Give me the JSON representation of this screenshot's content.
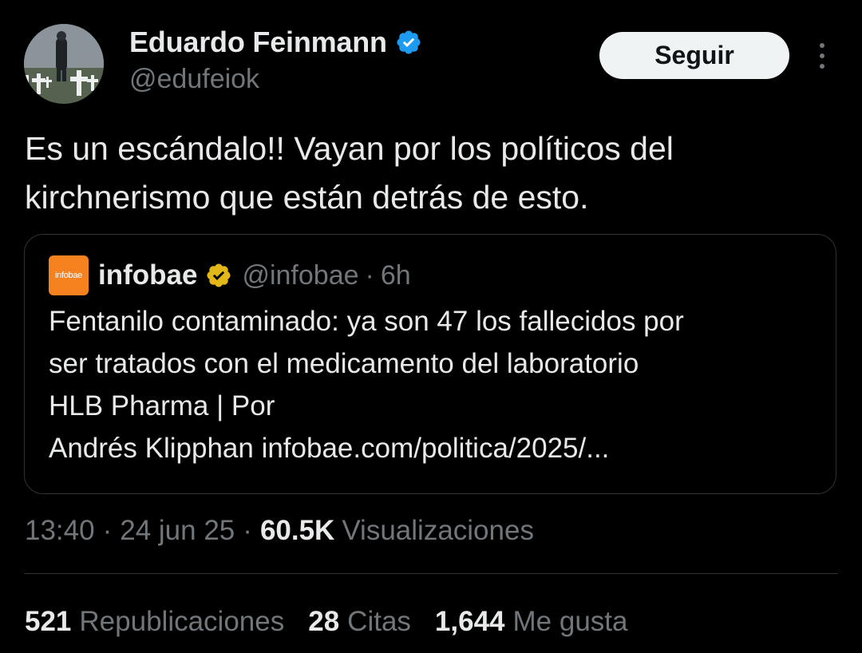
{
  "author": {
    "display_name": "Eduardo Feinmann",
    "handle": "@edufeiok",
    "verified_color": "#1d9bf0",
    "avatar_icon": "avatar-photo-cemetery-crosses"
  },
  "follow_button": {
    "label": "Seguir"
  },
  "more_menu": {
    "icon": "more-vertical-icon"
  },
  "tweet": {
    "text_line1": "Es un escándalo!!  Vayan por los políticos del",
    "text_line2": "kirchnerismo que están detrás de esto."
  },
  "quote": {
    "logo_text": "infobae",
    "logo_color": "#f5821f",
    "name": "infobae",
    "verified_color": "#e2b719",
    "handle": "@infobae",
    "separator": "·",
    "time": "6h",
    "lines": [
      "Fentanilo contaminado: ya son 47 los fallecidos por",
      "ser tratados con el medicamento del laboratorio",
      "HLB Pharma | Por",
      "Andrés Klipphan infobae.com/politica/2025/..."
    ]
  },
  "meta": {
    "time": "13:40",
    "separator": "·",
    "date": "24 jun 25",
    "views_count": "60.5K",
    "views_label": "Visualizaciones"
  },
  "stats": {
    "reposts_count": "521",
    "reposts_label": "Republicaciones",
    "quotes_count": "28",
    "quotes_label": "Citas",
    "likes_count": "1,644",
    "likes_label": "Me gusta"
  }
}
